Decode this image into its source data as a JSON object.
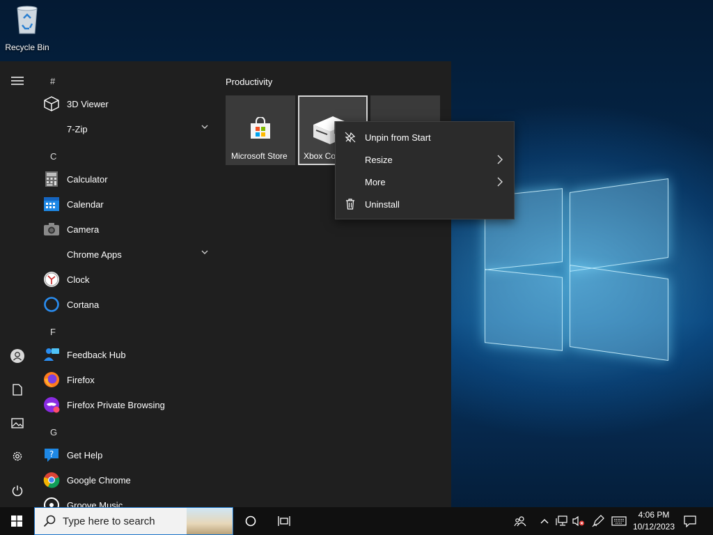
{
  "desktop": {
    "recycle_bin_label": "Recycle Bin"
  },
  "start_menu": {
    "letters": {
      "hash": "#",
      "c": "C",
      "f": "F",
      "g": "G"
    },
    "apps": {
      "viewer3d": "3D Viewer",
      "zip7": "7-Zip",
      "calculator": "Calculator",
      "calendar": "Calendar",
      "camera": "Camera",
      "chrome_apps": "Chrome Apps",
      "clock": "Clock",
      "cortana": "Cortana",
      "feedback_hub": "Feedback Hub",
      "firefox": "Firefox",
      "firefox_private": "Firefox Private Browsing",
      "get_help": "Get Help",
      "google_chrome": "Google Chrome",
      "groove_music": "Groove Music"
    },
    "tiles": {
      "group_title": "Productivity",
      "store": "Microsoft Store",
      "xbox": "Xbox Co"
    }
  },
  "context_menu": {
    "unpin": "Unpin from Start",
    "resize": "Resize",
    "more": "More",
    "uninstall": "Uninstall"
  },
  "taskbar": {
    "search_placeholder": "Type here to search",
    "time": "4:06 PM",
    "date": "10/12/2023"
  },
  "icons": {
    "start": "windows-logo-icon",
    "cortana": "circle-icon",
    "task_view": "task-view-icon",
    "people": "people-icon",
    "tray": "chevron-up-icon",
    "network": "network-icon",
    "volume": "volume-muted-icon",
    "pen": "pen-icon",
    "keyboard": "keyboard-icon",
    "notifications": "notification-icon"
  },
  "colors": {
    "accent": "#1a73c8",
    "menu_bg": "#1f1f1f",
    "tile_bg": "#3a3a3a",
    "context_bg": "#2b2b2b"
  }
}
